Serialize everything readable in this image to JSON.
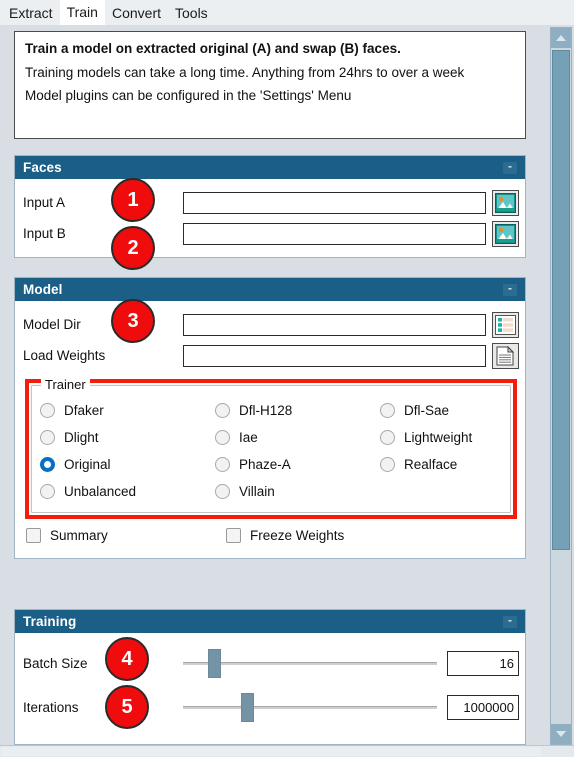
{
  "tabs": [
    {
      "label": "Extract",
      "active": false
    },
    {
      "label": "Train",
      "active": true
    },
    {
      "label": "Convert",
      "active": false
    },
    {
      "label": "Tools",
      "active": false
    }
  ],
  "description": {
    "title": "Train a model on extracted original (A) and swap (B) faces.",
    "line1": "Training models can take a long time. Anything from 24hrs to over a week",
    "line2": "Model plugins can be configured in the 'Settings' Menu"
  },
  "sections": {
    "faces": {
      "title": "Faces",
      "collapse": "-",
      "fields": [
        {
          "label": "Input A",
          "value": "",
          "placeholder": "",
          "icon": "image-picker-icon"
        },
        {
          "label": "Input B",
          "value": "",
          "placeholder": "",
          "icon": "image-picker-icon"
        }
      ]
    },
    "model": {
      "title": "Model",
      "collapse": "-",
      "fields": [
        {
          "label": "Model Dir",
          "value": "",
          "placeholder": "",
          "icon": "folder-list-icon"
        },
        {
          "label": "Load Weights",
          "value": "",
          "placeholder": "",
          "icon": "document-icon"
        }
      ],
      "trainer": {
        "legend": "Trainer",
        "selected": "Original",
        "options": [
          "Dfaker",
          "Dfl-H128",
          "Dfl-Sae",
          "Dlight",
          "Iae",
          "Lightweight",
          "Original",
          "Phaze-A",
          "Realface",
          "Unbalanced",
          "Villain",
          ""
        ]
      },
      "checkboxes": [
        {
          "label": "Summary",
          "checked": false
        },
        {
          "label": "Freeze Weights",
          "checked": false
        }
      ]
    },
    "training": {
      "title": "Training",
      "collapse": "-",
      "sliders": [
        {
          "label": "Batch Size",
          "value": "16",
          "percent": 10
        },
        {
          "label": "Iterations",
          "value": "1000000",
          "percent": 23
        }
      ]
    }
  },
  "badges": [
    {
      "number": "1"
    },
    {
      "number": "2"
    },
    {
      "number": "3"
    },
    {
      "number": "4"
    },
    {
      "number": "5"
    }
  ],
  "colors": {
    "section_header": "#1b5e86",
    "badge": "#f00c0c",
    "highlight_border": "#f41c0c",
    "radio_selected": "#0a6ec4"
  }
}
